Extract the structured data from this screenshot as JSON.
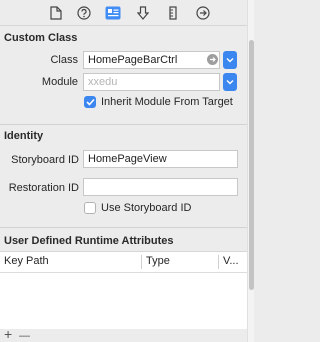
{
  "toolbar": {
    "tabs": [
      {
        "icon": "file-icon"
      },
      {
        "icon": "help-icon"
      },
      {
        "icon": "identity-icon"
      },
      {
        "icon": "attributes-icon"
      },
      {
        "icon": "size-icon"
      },
      {
        "icon": "connections-icon"
      }
    ],
    "accent": "#3c86f0"
  },
  "custom_class": {
    "title": "Custom Class",
    "class_label": "Class",
    "class_value": "HomePageBarCtrl",
    "module_label": "Module",
    "module_placeholder": "xxedu",
    "inherit_label": "Inherit Module From Target",
    "inherit_checked": true
  },
  "identity": {
    "title": "Identity",
    "storyboard_id_label": "Storyboard ID",
    "storyboard_id_value": "HomePageView",
    "restoration_id_label": "Restoration ID",
    "restoration_id_value": "",
    "use_storyboard_label": "Use Storyboard ID",
    "use_storyboard_checked": false
  },
  "runtime_attributes": {
    "title": "User Defined Runtime Attributes",
    "columns": [
      "Key Path",
      "Type",
      "V..."
    ],
    "rows": []
  },
  "bottom": {
    "add_label": "+",
    "remove_label": "—"
  }
}
